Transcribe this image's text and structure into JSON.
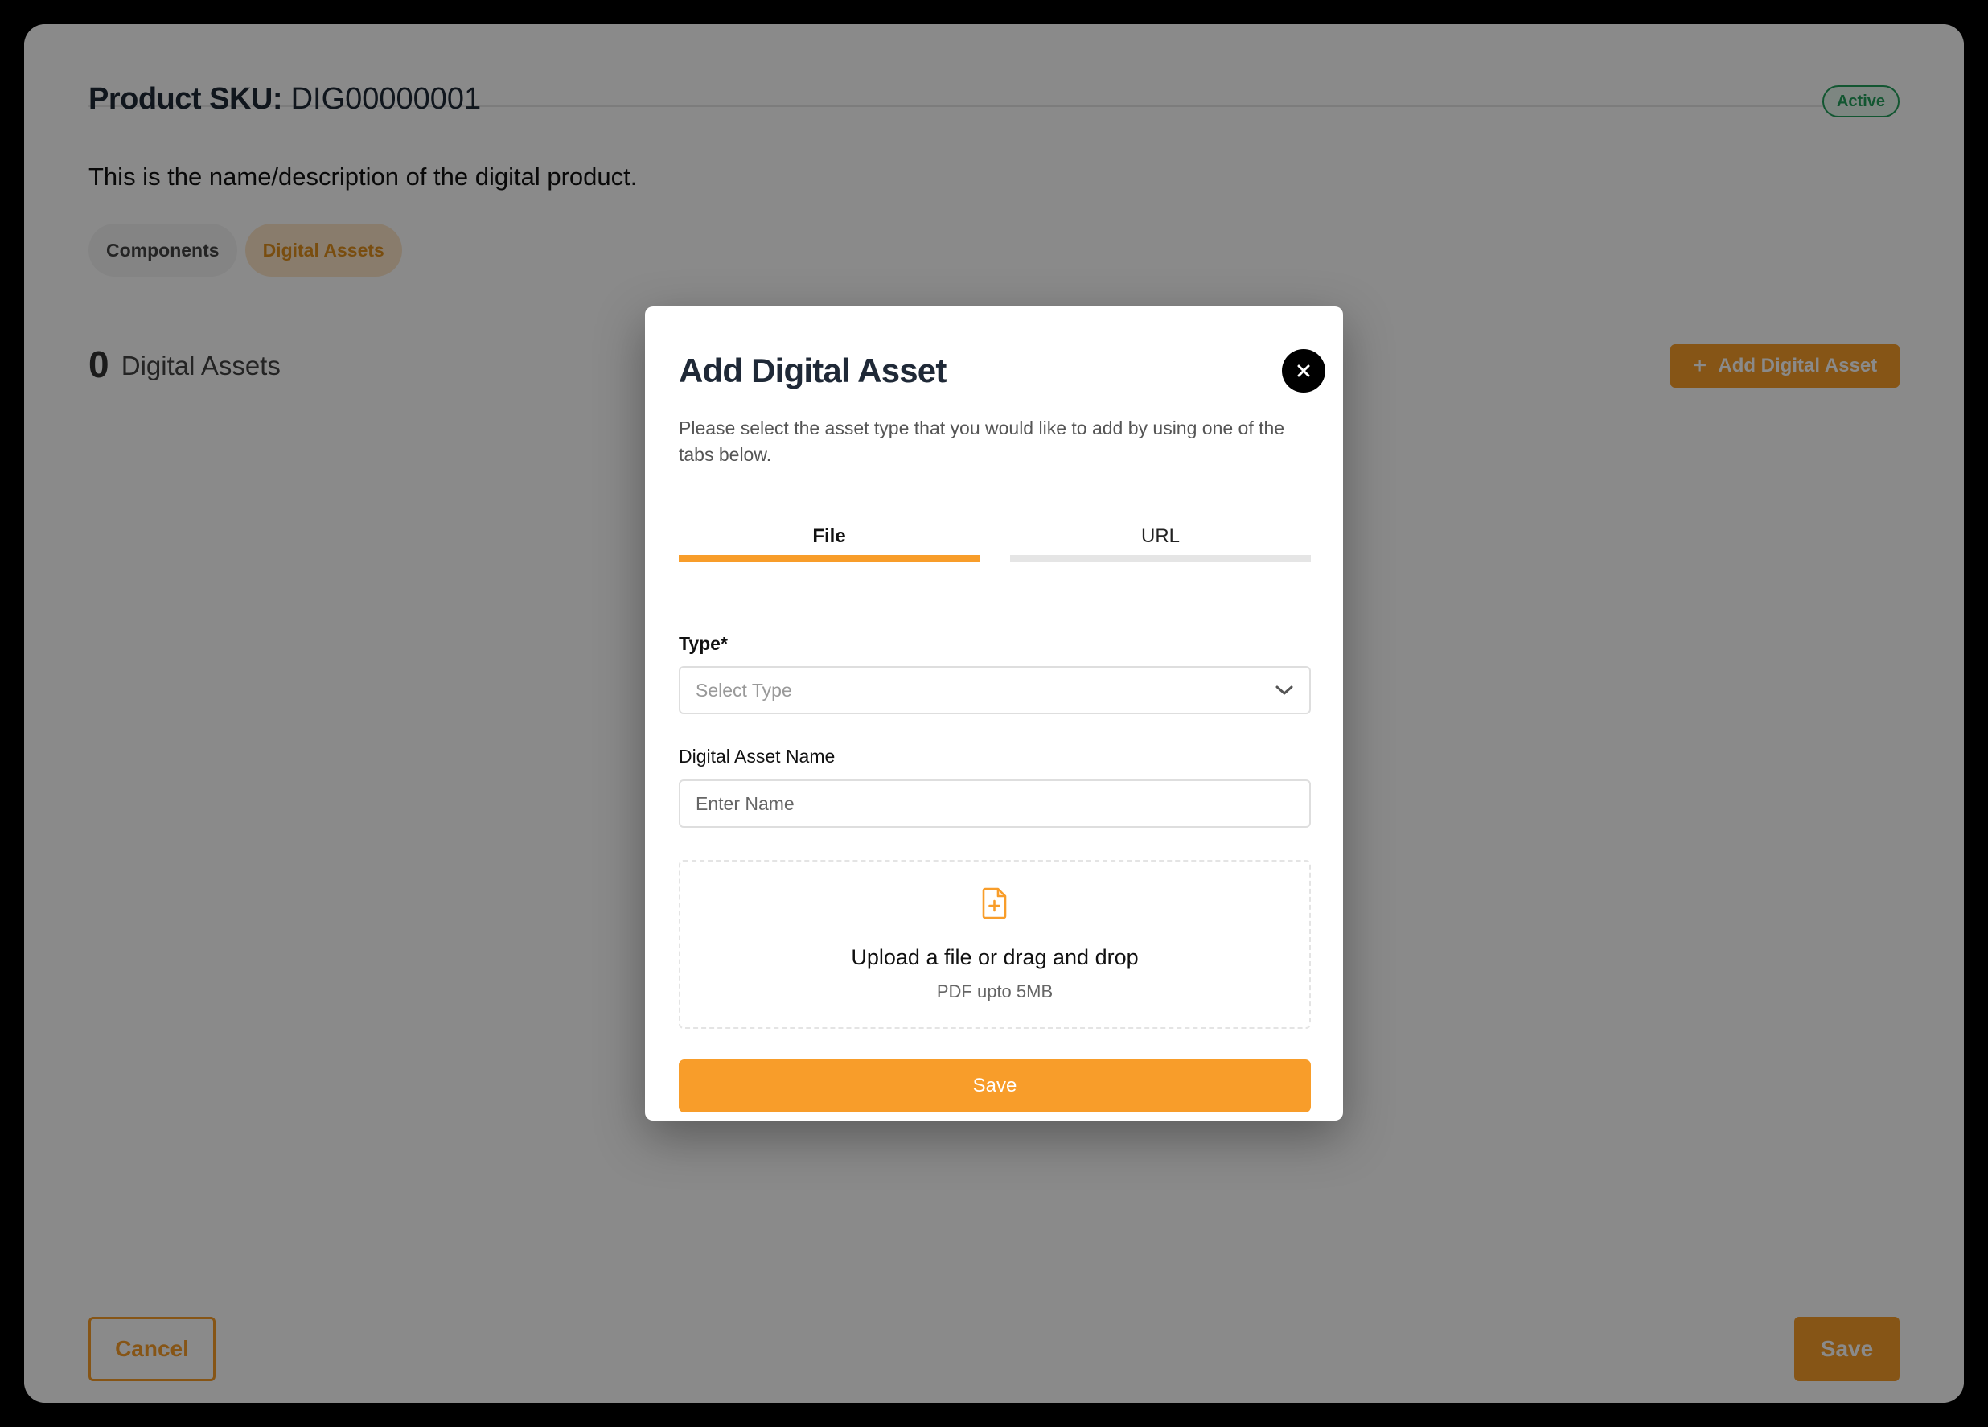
{
  "page": {
    "sku_label": "Product SKU:",
    "sku_value": "DIG00000001",
    "status": "Active",
    "description": "This is the name/description of the digital product.",
    "tabs": [
      {
        "label": "Components",
        "active": false
      },
      {
        "label": "Digital Assets",
        "active": true
      }
    ],
    "assets_count": "0",
    "assets_label": "Digital Assets",
    "add_button": "Add Digital Asset",
    "cancel_button": "Cancel",
    "save_button": "Save"
  },
  "modal": {
    "title": "Add Digital Asset",
    "description": "Please select the asset type that you would like to add by using one of the tabs below.",
    "tabs": [
      {
        "label": "File",
        "active": true
      },
      {
        "label": "URL",
        "active": false
      }
    ],
    "type_label": "Type*",
    "type_placeholder": "Select Type",
    "name_label": "Digital Asset Name",
    "name_placeholder": "Enter Name",
    "upload_title": "Upload a file or drag and drop",
    "upload_hint": "PDF upto 5MB",
    "save_button": "Save"
  },
  "icons": {
    "close": "close-icon",
    "chevron": "chevron-down-icon",
    "upload": "file-plus-icon",
    "plus": "plus-icon"
  },
  "colors": {
    "accent": "#f89d2a",
    "status_green": "#22a05b",
    "overlay": "rgba(0,0,0,0.46)"
  }
}
